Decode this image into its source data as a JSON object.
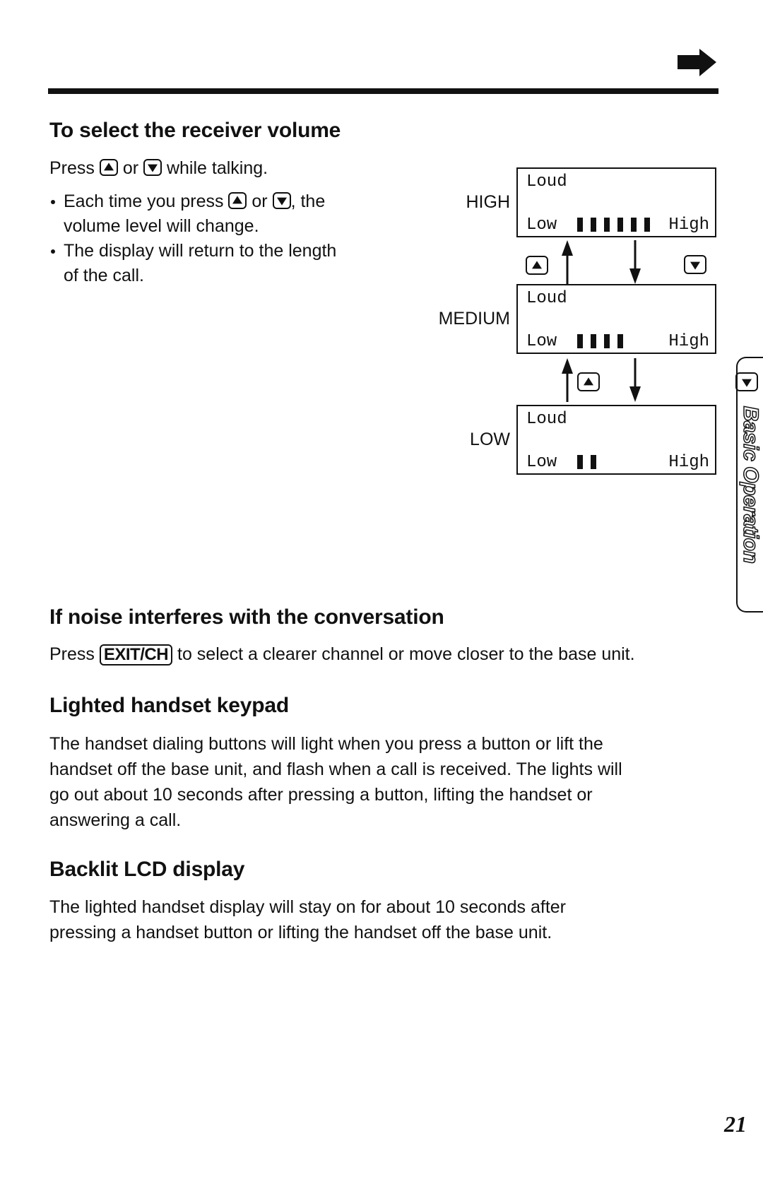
{
  "header": {
    "continue_icon": "right-arrow-icon"
  },
  "section_receiver_volume": {
    "title": "To select the receiver volume",
    "press_prefix": "Press",
    "press_or": "or",
    "press_suffix": "while talking.",
    "bullets": [
      {
        "prefix": "Each time you press",
        "or": "or",
        "suffix": ", the",
        "line2": "volume level will change."
      },
      {
        "line1": "The display will return to the length",
        "line2": "of the call."
      }
    ],
    "up_key_icon": "volume-up-key-icon",
    "down_key_icon": "volume-down-key-icon"
  },
  "volume_diagram": {
    "levels": [
      {
        "name": "HIGH",
        "top_text": "Loud",
        "low_label": "Low",
        "high_label": "High",
        "bars": 6,
        "max_bars": 6
      },
      {
        "name": "MEDIUM",
        "top_text": "Loud",
        "low_label": "Low",
        "high_label": "High",
        "bars": 4,
        "max_bars": 6
      },
      {
        "name": "LOW",
        "top_text": "Loud",
        "low_label": "Low",
        "high_label": "High",
        "bars": 2,
        "max_bars": 6
      }
    ]
  },
  "section_noise": {
    "title": "If noise interferes with the conversation",
    "press_prefix": "Press",
    "key_label": "EXIT/CH",
    "press_suffix": "to select a clearer channel or move closer to the base unit."
  },
  "section_keypad": {
    "title": "Lighted handset keypad",
    "lines": [
      "The handset dialing buttons will light when you press a button or lift the",
      "handset off the base unit, and flash when a call is received. The lights will",
      "go out about 10 seconds after pressing a button, lifting the handset or",
      "answering a call."
    ]
  },
  "section_backlit": {
    "title": "Backlit LCD display",
    "lines": [
      "The lighted handset display will stay on for about 10 seconds after",
      "pressing a handset button or lifting the handset off the base unit."
    ]
  },
  "side_tab": {
    "label": "Basic Operation"
  },
  "footer": {
    "page_number": "21"
  }
}
